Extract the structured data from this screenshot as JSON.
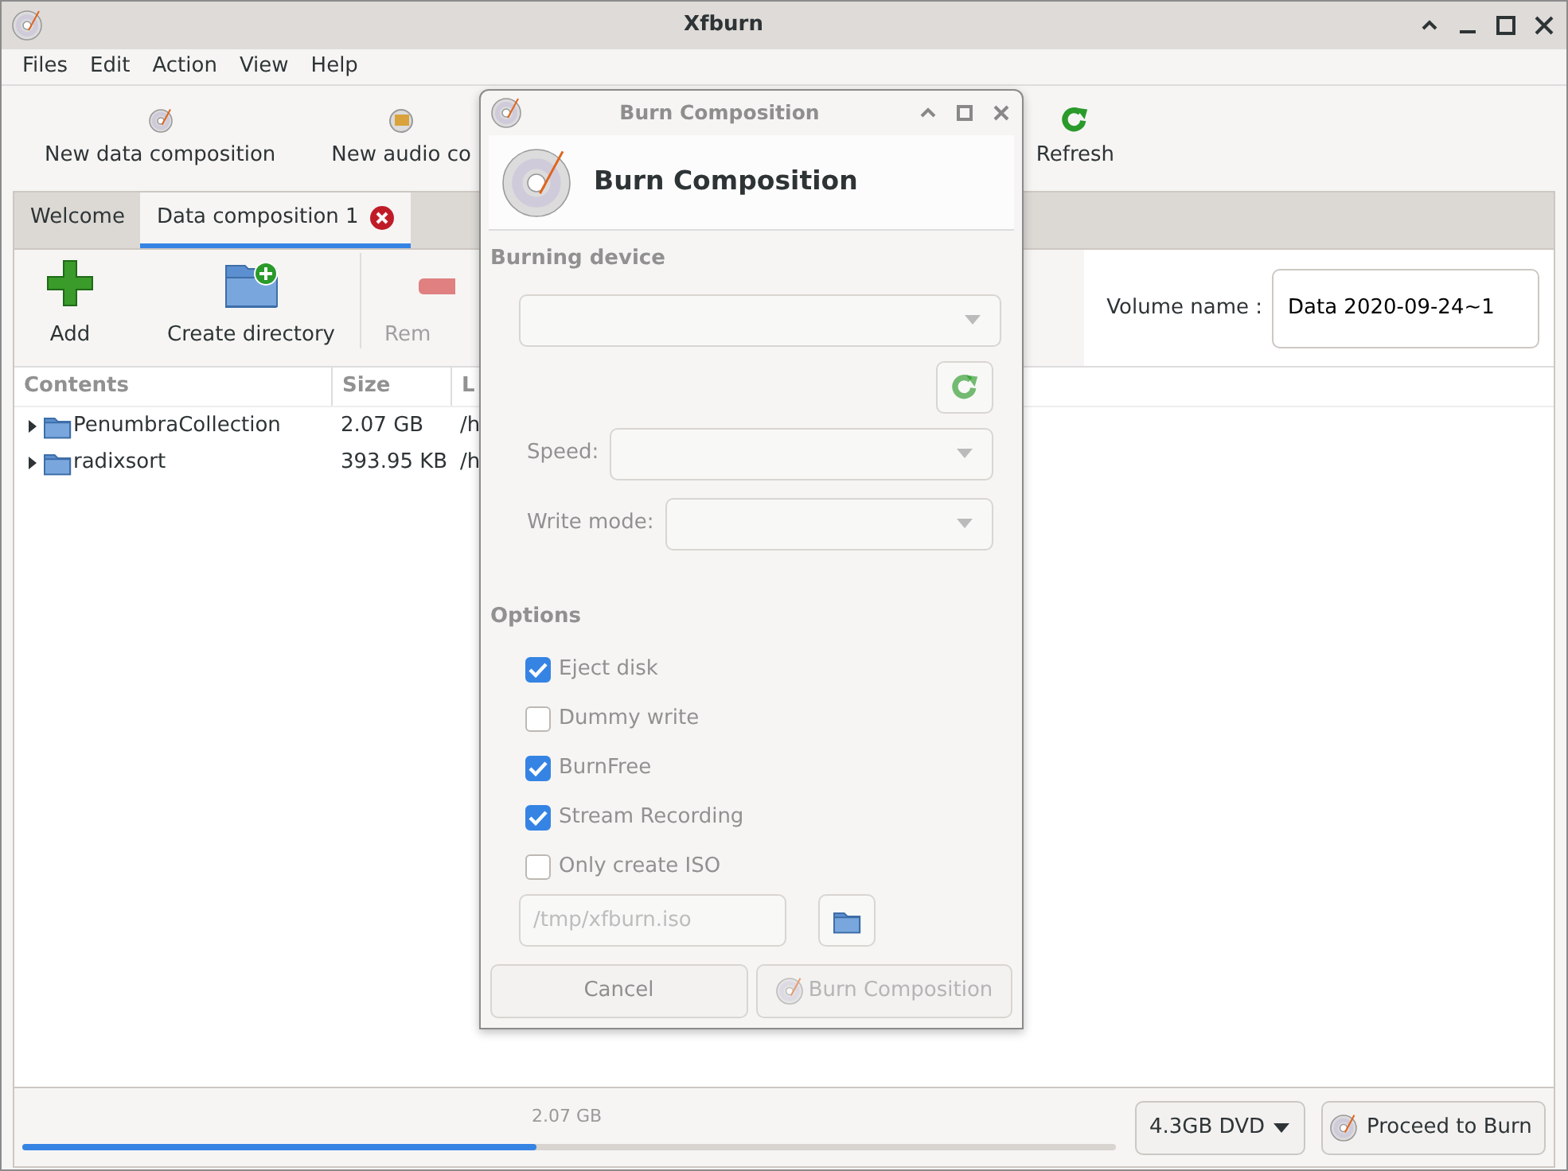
{
  "window": {
    "title": "Xfburn"
  },
  "menu": [
    "Files",
    "Edit",
    "Action",
    "View",
    "Help"
  ],
  "toolbar": [
    {
      "label": "New data composition",
      "kind": "data"
    },
    {
      "label": "New audio co",
      "kind": "audio"
    },
    {
      "label": "Refresh",
      "kind": "refresh"
    }
  ],
  "tabs": [
    {
      "label": "Welcome",
      "selected": false,
      "closable": false
    },
    {
      "label": "Data composition 1",
      "selected": true,
      "closable": true
    }
  ],
  "composition_toolbar": [
    {
      "label": "Add",
      "kind": "add",
      "disabled": false
    },
    {
      "label": "Create directory",
      "kind": "folder",
      "disabled": false
    },
    {
      "label": "Rem",
      "kind": "remove",
      "disabled": true
    }
  ],
  "volume": {
    "label": "Volume name :",
    "value": "Data 2020-09-24~1"
  },
  "table": {
    "columns": [
      "Contents",
      "Size",
      "L"
    ],
    "rows": [
      {
        "name": "PenumbraCollection",
        "size": "2.07 GB",
        "location": "/h",
        "expanded": false
      },
      {
        "name": "radixsort",
        "size": "393.95 KB",
        "location": "/h",
        "expanded": false
      }
    ]
  },
  "status_bar": {
    "size": "2.07 GB",
    "level": 0.47,
    "disc": "4.3GB DVD",
    "proceed": "Proceed to Burn"
  },
  "dialog": {
    "title": "Burn Composition",
    "heading": "Burn Composition",
    "device_section": "Burning device",
    "speed_label": "Speed:",
    "write_mode_label": "Write mode:",
    "options_heading": "Options",
    "options": [
      {
        "label": "Eject disk",
        "checked": true
      },
      {
        "label": "Dummy write",
        "checked": false
      },
      {
        "label": "BurnFree",
        "checked": true
      },
      {
        "label": "Stream Recording",
        "checked": true
      },
      {
        "label": "Only create ISO",
        "checked": false
      }
    ],
    "iso_path": {
      "value": "/tmp/xfburn.iso",
      "disabled": true
    },
    "buttons": [
      {
        "label": "Cancel",
        "disabled": false,
        "icon": false
      },
      {
        "label": "Burn Composition",
        "disabled": true,
        "icon": true
      }
    ]
  }
}
